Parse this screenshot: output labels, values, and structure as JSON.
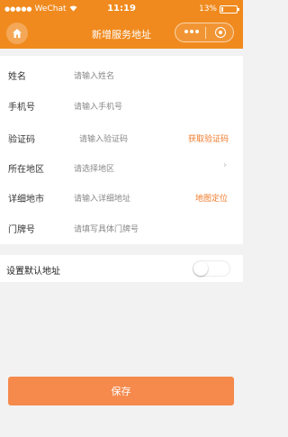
{
  "status_bar": {
    "signal": "●●●●●",
    "carrier": "WeChat",
    "time": "11:19",
    "battery": "13%"
  },
  "nav": {
    "title": "新增服务地址"
  },
  "form": {
    "name": {
      "label": "姓名",
      "placeholder": "请输入姓名"
    },
    "phone": {
      "label": "手机号",
      "placeholder": "请输入手机号"
    },
    "code": {
      "label": "验证码",
      "placeholder": "请输入验证码",
      "action": "获取验证码"
    },
    "region": {
      "label": "所在地区",
      "placeholder": "请选择地区",
      "chevron": "›"
    },
    "address": {
      "label": "详细地市",
      "placeholder": "请输入详细地址",
      "action": "地图定位"
    },
    "door": {
      "label": "门牌号",
      "placeholder": "请填写具体门牌号"
    }
  },
  "default_address": {
    "label": "设置默认地址",
    "enabled": false
  },
  "save_label": "保存",
  "colors": {
    "brand": "#f08a1e",
    "save_button": "#f58a4c",
    "action_text": "#f07a2a"
  },
  "icons": {
    "home": "home-icon",
    "more": "more-dots-icon",
    "close": "capsule-close-icon",
    "wifi": "wifi-icon",
    "battery": "battery-icon",
    "chevron": "chevron-right-icon"
  }
}
